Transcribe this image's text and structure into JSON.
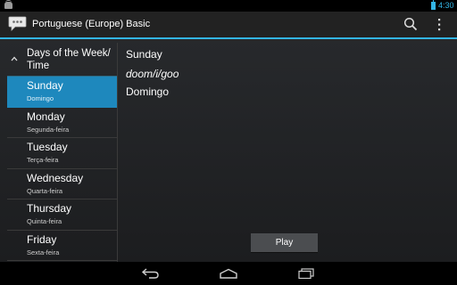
{
  "status_bar": {
    "time": "4:30",
    "icons": [
      "notification-icon",
      "battery-icon"
    ]
  },
  "action_bar": {
    "title": "Portuguese (Europe) Basic",
    "icons": [
      "app-chat-icon",
      "search-icon",
      "overflow-menu-icon"
    ]
  },
  "list": {
    "group_header": "Days of the Week/ Time",
    "items": [
      {
        "primary": "Sunday",
        "secondary": "Domingo",
        "selected": true
      },
      {
        "primary": "Monday",
        "secondary": "Segunda-feira",
        "selected": false
      },
      {
        "primary": "Tuesday",
        "secondary": "Terça-feira",
        "selected": false
      },
      {
        "primary": "Wednesday",
        "secondary": "Quarta-feira",
        "selected": false
      },
      {
        "primary": "Thursday",
        "secondary": "Quinta-feira",
        "selected": false
      },
      {
        "primary": "Friday",
        "secondary": "Sexta-feira",
        "selected": false
      }
    ]
  },
  "detail": {
    "english": "Sunday",
    "phonetic": "doom/i/goo",
    "translation": "Domingo",
    "play_label": "Play"
  },
  "nav_bar": {
    "icons": [
      "back-icon",
      "home-icon",
      "recent-apps-icon"
    ]
  },
  "colors": {
    "accent": "#33b5e5",
    "selected_item": "#1e88bd",
    "action_bar": "#222222"
  }
}
